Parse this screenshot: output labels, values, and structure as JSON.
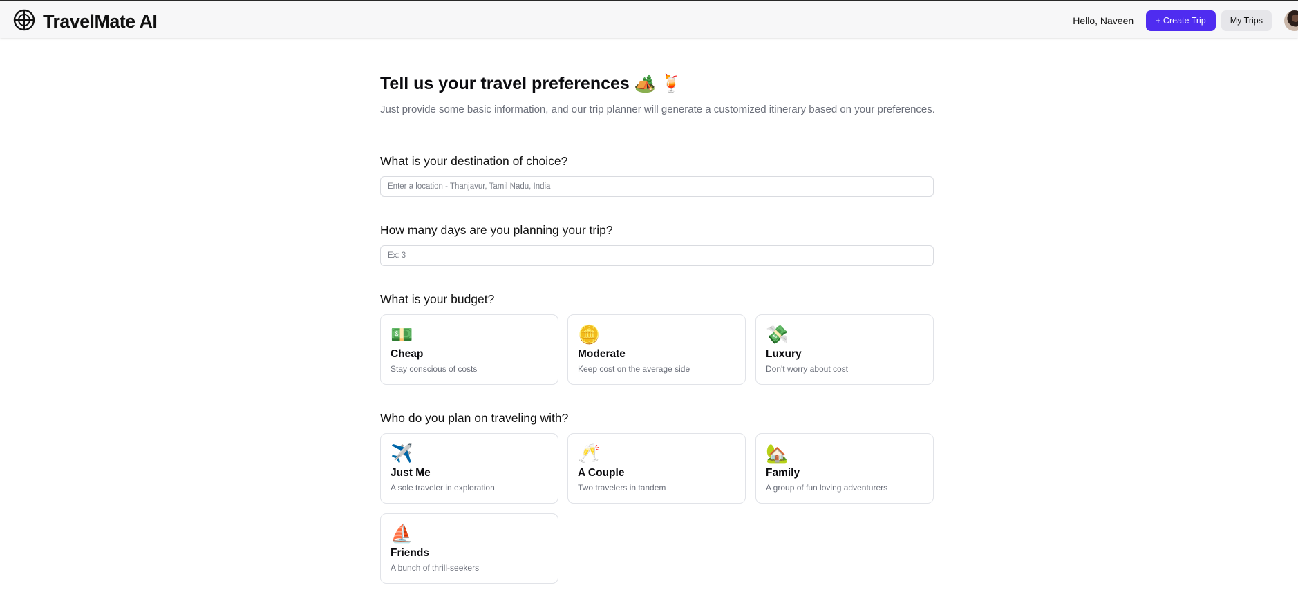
{
  "header": {
    "brand": "TravelMate AI",
    "greeting": "Hello, Naveen",
    "create_trip_label": "+ Create Trip",
    "my_trips_label": "My Trips",
    "accent_color": "#4f2cf0"
  },
  "page": {
    "title": "Tell us your travel preferences 🏕️ 🍹",
    "subtitle": "Just provide some basic information, and our trip planner will generate a customized itinerary based on your preferences."
  },
  "destination": {
    "label": "What is your destination of choice?",
    "placeholder": "Enter a location - Thanjavur, Tamil Nadu, India",
    "value": ""
  },
  "days": {
    "label": "How many days are you planning your trip?",
    "placeholder": "Ex: 3",
    "value": ""
  },
  "budget": {
    "label": "What is your budget?",
    "options": [
      {
        "icon": "💵",
        "icon_name": "cash-icon",
        "title": "Cheap",
        "desc": "Stay conscious of costs"
      },
      {
        "icon": "🪙",
        "icon_name": "coin-icon",
        "title": "Moderate",
        "desc": "Keep cost on the average side"
      },
      {
        "icon": "💸",
        "icon_name": "money-with-wings-icon",
        "title": "Luxury",
        "desc": "Don't worry about cost"
      }
    ]
  },
  "companions": {
    "label": "Who do you plan on traveling with?",
    "options": [
      {
        "icon": "✈️",
        "icon_name": "airplane-icon",
        "title": "Just Me",
        "desc": "A sole traveler in exploration"
      },
      {
        "icon": "🥂",
        "icon_name": "clinking-glasses-icon",
        "title": "A Couple",
        "desc": "Two travelers in tandem"
      },
      {
        "icon": "🏡",
        "icon_name": "house-icon",
        "title": "Family",
        "desc": "A group of fun loving adventurers"
      },
      {
        "icon": "⛵",
        "icon_name": "sailboat-icon",
        "title": "Friends",
        "desc": "A bunch of thrill-seekers"
      }
    ]
  }
}
